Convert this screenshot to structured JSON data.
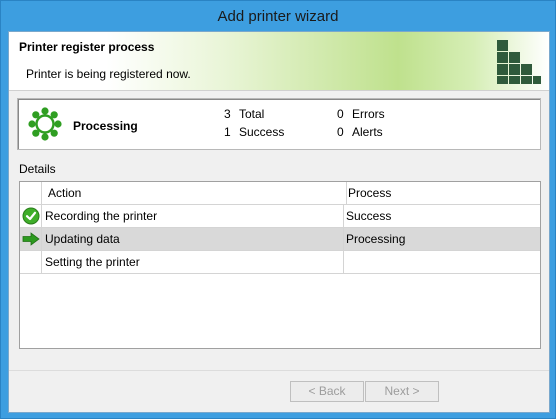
{
  "window": {
    "title": "Add printer wizard"
  },
  "header": {
    "title": "Printer register process",
    "subtitle": "Printer is being registered now."
  },
  "status": {
    "label": "Processing",
    "total_count": "3",
    "total_label": "Total",
    "success_count": "1",
    "success_label": "Success",
    "errors_count": "0",
    "errors_label": "Errors",
    "alerts_count": "0",
    "alerts_label": "Alerts"
  },
  "details": {
    "label": "Details",
    "columns": [
      "Action",
      "Process"
    ],
    "rows": [
      {
        "icon": "check-circle-icon",
        "action": "Recording the printer",
        "process": "Success"
      },
      {
        "icon": "arrow-right-icon",
        "action": "Updating data",
        "process": "Processing"
      },
      {
        "icon": "",
        "action": "Setting the printer",
        "process": ""
      }
    ]
  },
  "buttons": {
    "back": "< Back",
    "next": "Next >"
  },
  "colors": {
    "title_bar": "#3d9ee0",
    "logo": "#2f5a3b",
    "spinner": "#2f9e22",
    "selected_row": "#d9d9d9"
  }
}
